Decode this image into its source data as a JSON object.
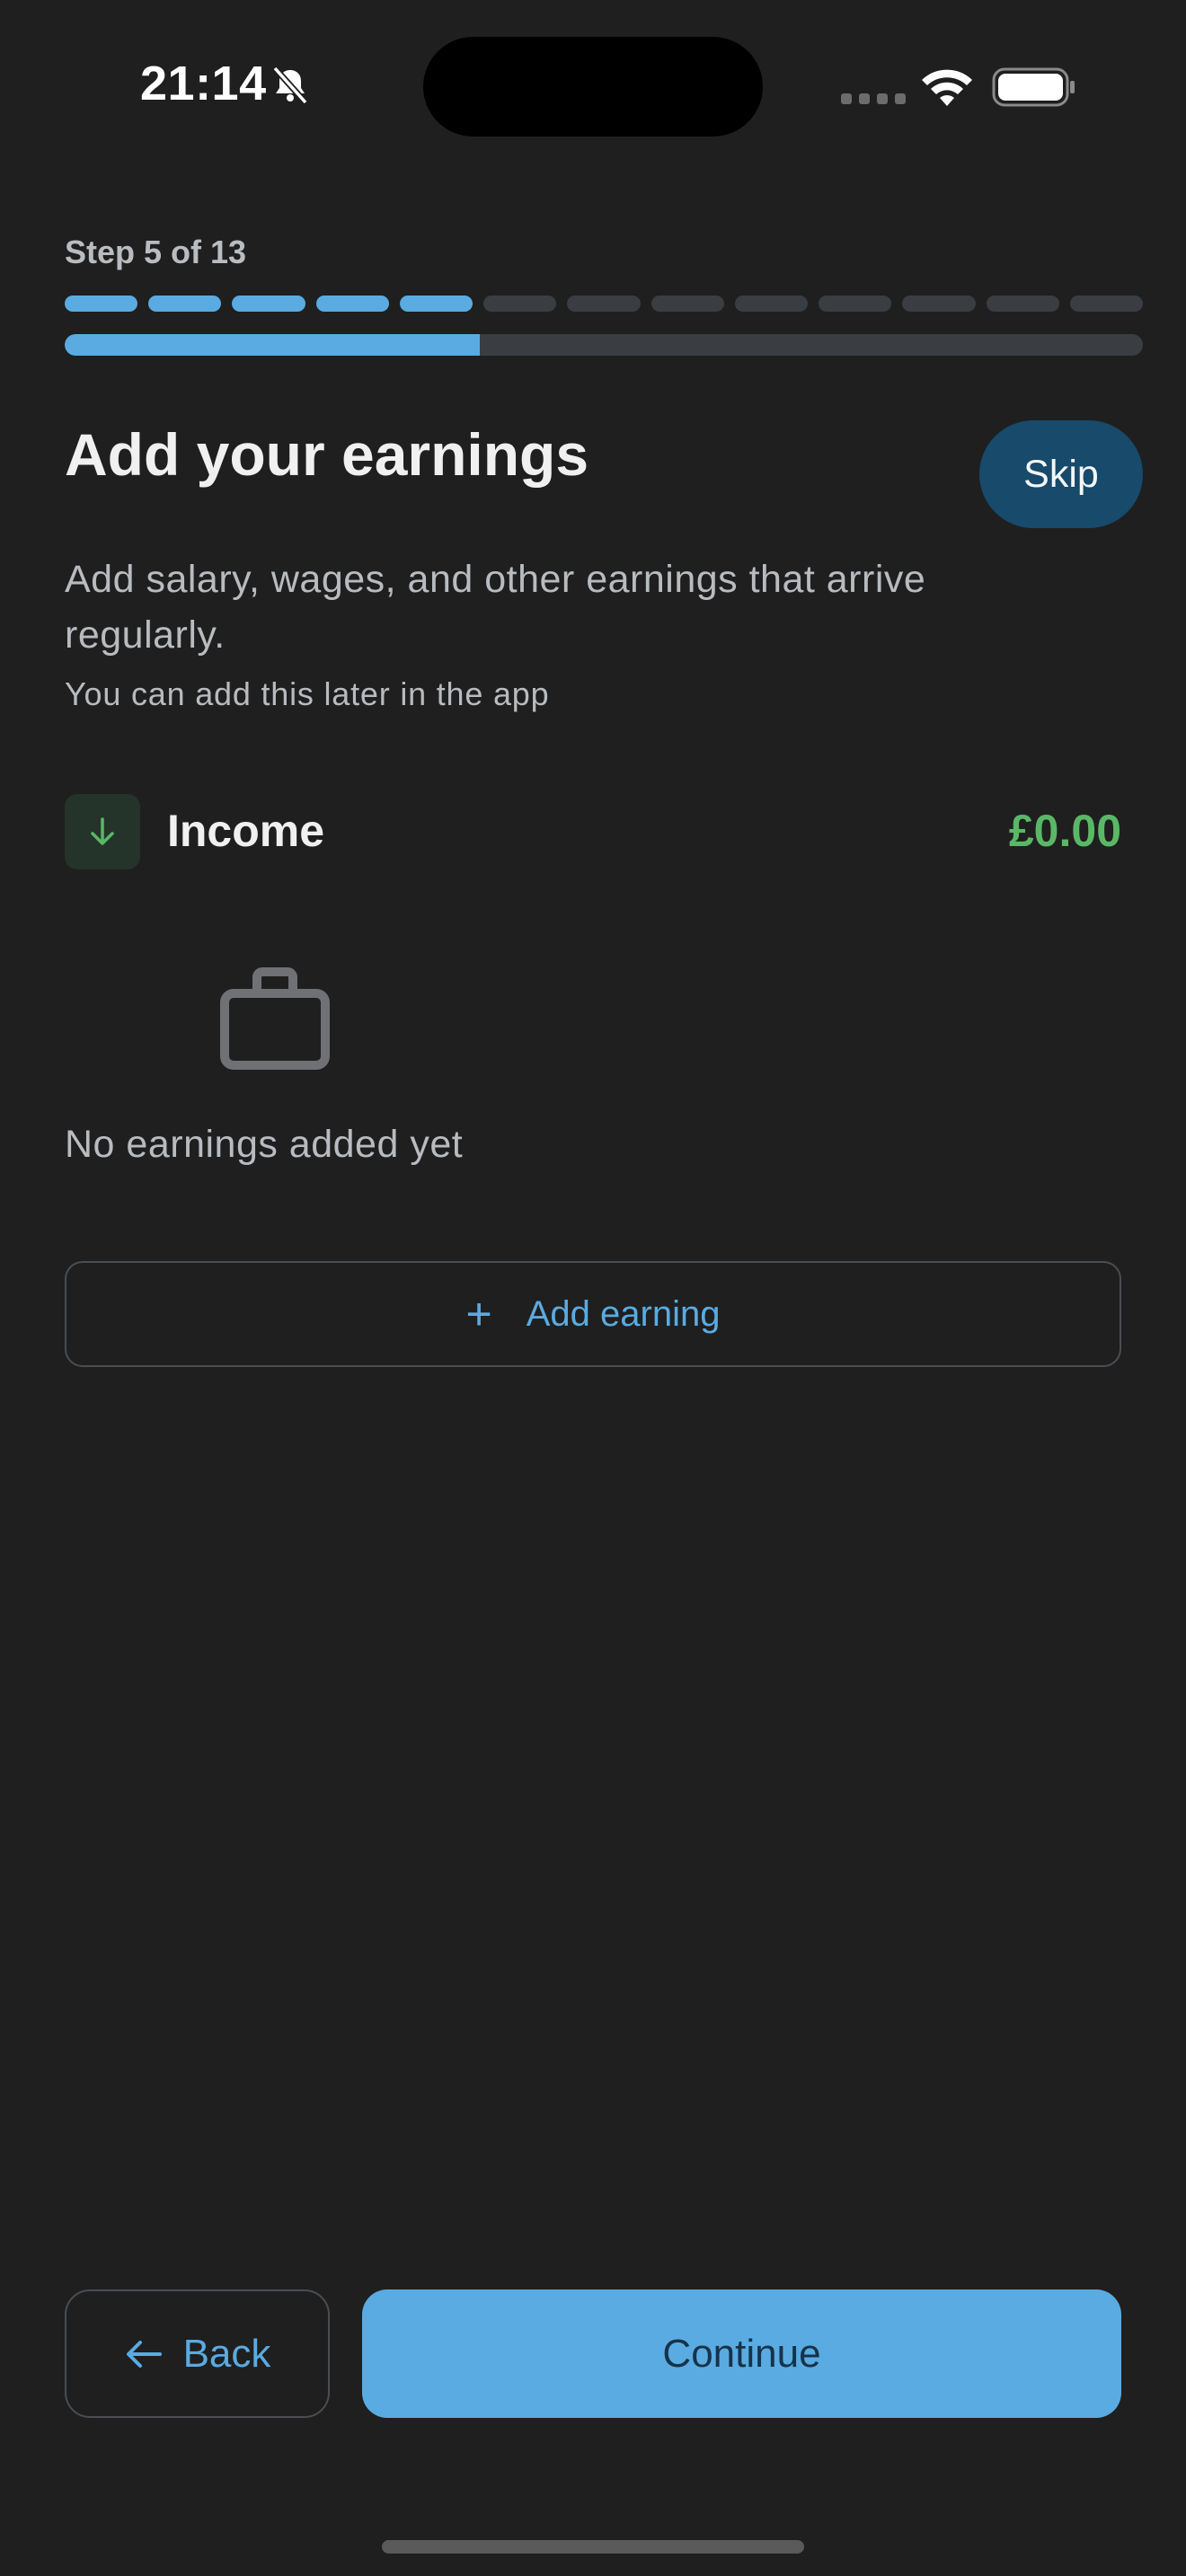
{
  "status_bar": {
    "time": "21:14",
    "icons": [
      "bell-slash-icon",
      "cellular-signal-icon",
      "wifi-icon",
      "battery-icon"
    ]
  },
  "step": {
    "label": "Step 5 of 13",
    "current": 5,
    "total": 13
  },
  "header": {
    "title": "Add your earnings",
    "skip_label": "Skip"
  },
  "description": "Add salary, wages, and other earnings that arrive regularly.",
  "hint": "You can add this later in the app",
  "income": {
    "icon": "arrow-down-icon",
    "label": "Income",
    "amount": "£0.00"
  },
  "empty_state": {
    "icon": "briefcase-icon",
    "text": "No earnings added yet"
  },
  "add_button": {
    "icon": "plus-icon",
    "label": "Add earning"
  },
  "footer": {
    "back_label": "Back",
    "continue_label": "Continue"
  },
  "colors": {
    "background": "#1f1f1f",
    "accent": "#5aabe1",
    "income_green": "#5ab766",
    "skip_bg": "#174a6b",
    "track": "#3a3d42"
  }
}
